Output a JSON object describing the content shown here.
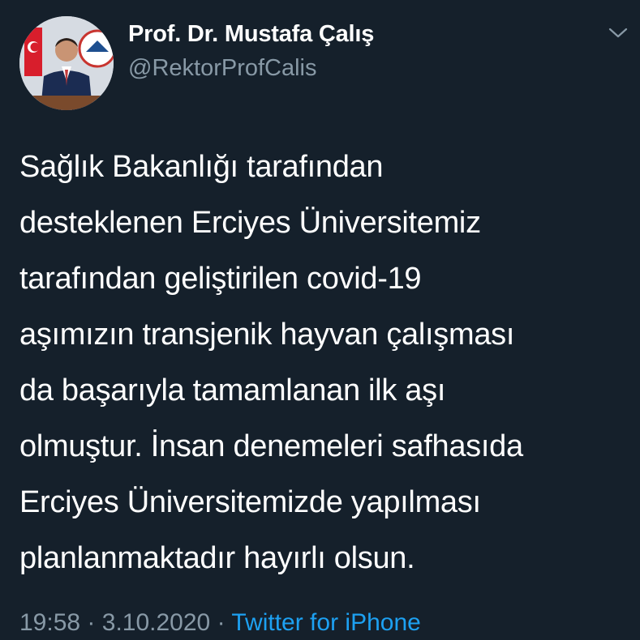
{
  "author": {
    "display_name": "Prof. Dr. Mustafa Çalış",
    "handle": "@RektorProfCalis"
  },
  "tweet": {
    "text": "Sağlık Bakanlığı tarafından\ndesteklenen Erciyes Üniversitemiz\ntarafından geliştirilen covid-19\naşımızın transjenik hayvan çalışması\nda başarıyla tamamlanan ilk aşı\nolmuştur. İnsan denemeleri safhasıda\nErciyes Üniversitemizde yapılması\nplanlanmaktadır hayırlı olsun.",
    "time": "19:58",
    "date": "3.10.2020",
    "separator": "·",
    "source": "Twitter for iPhone"
  },
  "icons": {
    "menu": "chevron-down-icon",
    "avatar": "profile-photo"
  },
  "colors": {
    "background": "#15202b",
    "text": "#ffffff",
    "secondary": "#8899a6",
    "link": "#1da1f2"
  }
}
